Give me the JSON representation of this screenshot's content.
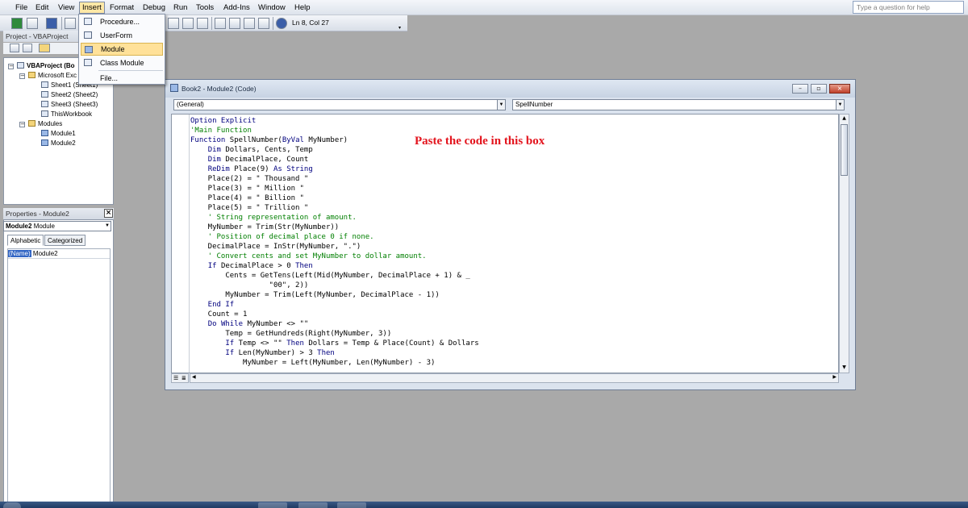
{
  "menubar": {
    "items": [
      "File",
      "Edit",
      "View",
      "Insert",
      "Format",
      "Debug",
      "Run",
      "Tools",
      "Add-Ins",
      "Window",
      "Help"
    ],
    "active": "Insert",
    "help_placeholder": "Type a question for help"
  },
  "toolbar": {
    "cursor_position": "Ln 8, Col 27"
  },
  "insert_menu": {
    "items": [
      "Procedure...",
      "UserForm",
      "Module",
      "Class Module",
      "File..."
    ],
    "highlighted": "Module"
  },
  "project": {
    "title": "Project - VBAProject",
    "tree": [
      "VBAProject (Bo",
      "Microsoft Exc",
      "Sheet1 (Sheet1)",
      "Sheet2 (Sheet2)",
      "Sheet3 (Sheet3)",
      "ThisWorkbook",
      "Modules",
      "Module1",
      "Module2"
    ]
  },
  "properties": {
    "title": "Properties - Module2",
    "object_name": "Module2",
    "object_type": "Module",
    "tabs": [
      "Alphabetic",
      "Categorized"
    ],
    "prop_name": "(Name)",
    "prop_value": "Module2"
  },
  "code_window": {
    "title": "Book2 - Module2 (Code)",
    "object_combo": "(General)",
    "procedure_combo": "SpellNumber",
    "lines": [
      {
        "text": "Option Explicit",
        "style": "kw"
      },
      {
        "text": "'Main Function",
        "style": "cm"
      },
      {
        "text": "Function SpellNumber(ByVal MyNumber)",
        "style": "mixed1"
      },
      {
        "text": "    Dim Dollars, Cents, Temp",
        "style": "dim"
      },
      {
        "text": "    Dim DecimalPlace, Count",
        "style": "dim"
      },
      {
        "text": "    ReDim Place(9) As String",
        "style": "redim"
      },
      {
        "text": "    Place(2) = \" Thousand \"",
        "style": "plain"
      },
      {
        "text": "    Place(3) = \" Million \"",
        "style": "plain"
      },
      {
        "text": "    Place(4) = \" Billion \"",
        "style": "plain"
      },
      {
        "text": "    Place(5) = \" Trillion \"",
        "style": "plain"
      },
      {
        "text": "    ' String representation of amount.",
        "style": "cm"
      },
      {
        "text": "    MyNumber = Trim(Str(MyNumber))",
        "style": "plain"
      },
      {
        "text": "    ' Position of decimal place 0 if none.",
        "style": "cm"
      },
      {
        "text": "    DecimalPlace = InStr(MyNumber, \".\")",
        "style": "plain"
      },
      {
        "text": "    ' Convert cents and set MyNumber to dollar amount.",
        "style": "cm"
      },
      {
        "text": "    If DecimalPlace > 0 Then",
        "style": "ifthen"
      },
      {
        "text": "        Cents = GetTens(Left(Mid(MyNumber, DecimalPlace + 1) & _",
        "style": "plain"
      },
      {
        "text": "                  \"00\", 2))",
        "style": "plain"
      },
      {
        "text": "        MyNumber = Trim(Left(MyNumber, DecimalPlace - 1))",
        "style": "plain"
      },
      {
        "text": "    End If",
        "style": "kw"
      },
      {
        "text": "    Count = 1",
        "style": "plain"
      },
      {
        "text": "    Do While MyNumber <> \"\"",
        "style": "dowhile"
      },
      {
        "text": "        Temp = GetHundreds(Right(MyNumber, 3))",
        "style": "plain"
      },
      {
        "text": "        If Temp <> \"\" Then Dollars = Temp & Place(Count) & Dollars",
        "style": "ifthen2"
      },
      {
        "text": "        If Len(MyNumber) > 3 Then",
        "style": "ifthen"
      },
      {
        "text": "            MyNumber = Left(MyNumber, Len(MyNumber) - 3)",
        "style": "plain"
      }
    ]
  },
  "annotation": {
    "text": "Paste the code in this box",
    "color": "#e3141d"
  }
}
